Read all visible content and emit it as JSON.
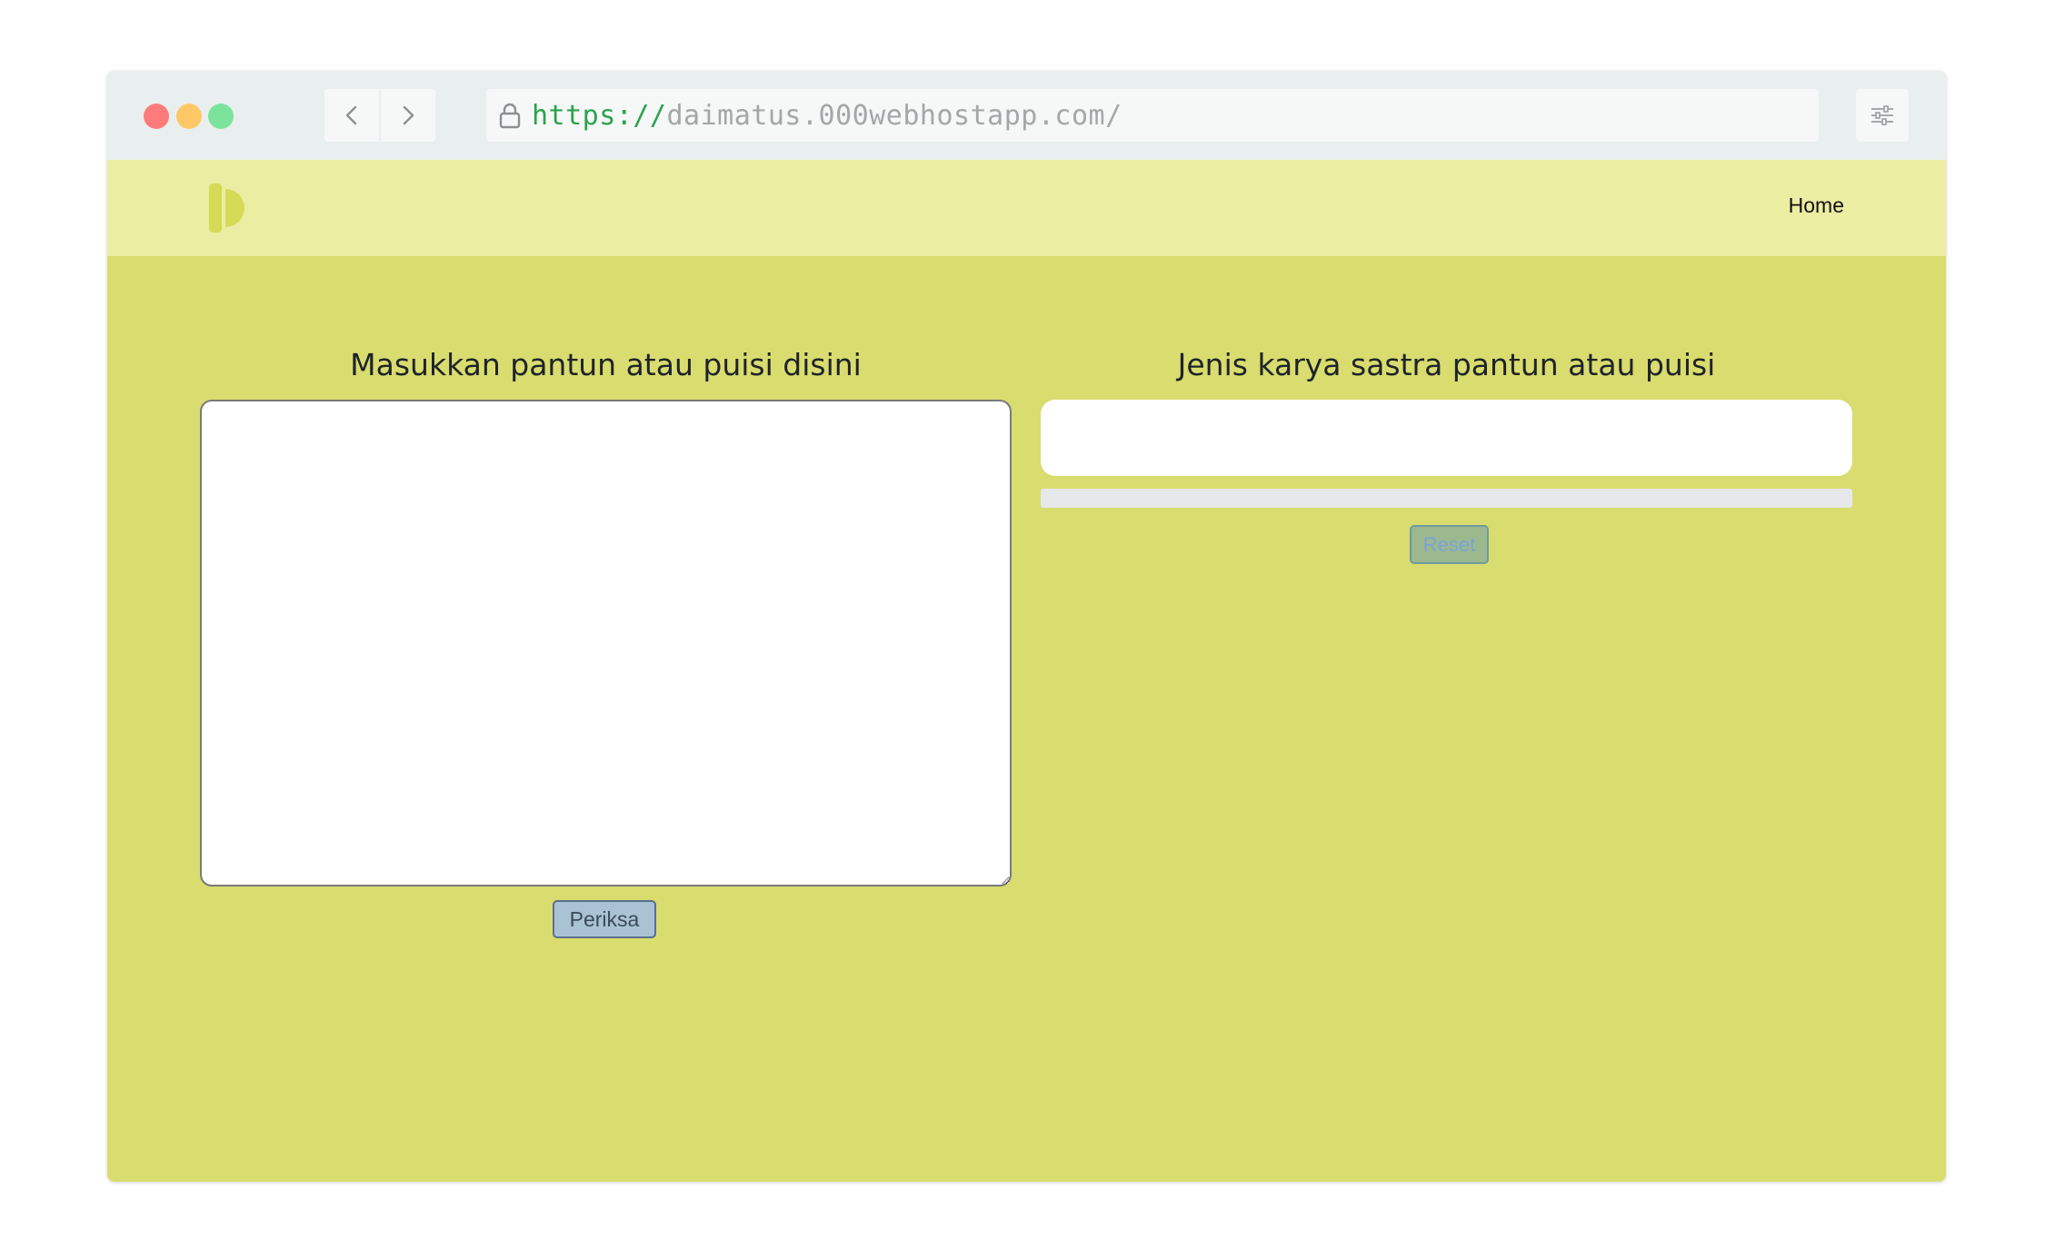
{
  "browser": {
    "url_scheme": "https://",
    "url_host": "daimatus.000webhostapp.com/",
    "icons": {
      "back": "chevron-left-icon",
      "forward": "chevron-right-icon",
      "lock": "lock-icon",
      "settings": "sliders-icon"
    }
  },
  "site": {
    "nav": {
      "home_label": "Home"
    },
    "logo": "D-logo"
  },
  "main": {
    "left_panel": {
      "title": "Masukkan pantun atau puisi disini",
      "textarea_value": "",
      "submit_label": "Periksa"
    },
    "right_panel": {
      "title": "Jenis karya sastra pantun atau puisi",
      "result_value": "",
      "progress_percent": 0,
      "reset_label": "Reset"
    }
  },
  "colors": {
    "page_background": "#d9dc6e",
    "navbar_background": "#ebeda3",
    "logo": "#d5da57",
    "submit_button": "#a9c3d5",
    "reset_button": "#9cb98e"
  }
}
